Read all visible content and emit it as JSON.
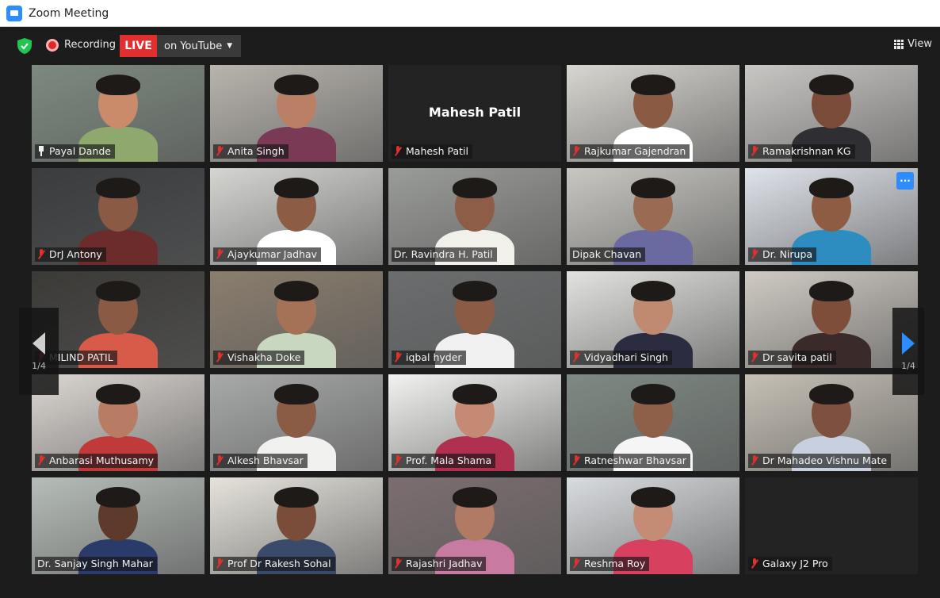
{
  "window": {
    "title": "Zoom Meeting"
  },
  "toolbar": {
    "recording_label": "Recording",
    "live_label": "LIVE",
    "youtube_label": "on YouTube",
    "view_label": "View"
  },
  "colors": {
    "accent": "#2d8cff",
    "live_red": "#e02f2f",
    "active_speaker": "#b9e35a",
    "muted_mic": "#e03030"
  },
  "pagination": {
    "left": "1/4",
    "right": "1/4"
  },
  "participants": [
    {
      "name": "Payal Dande",
      "status": "pinned",
      "active_speaker": true
    },
    {
      "name": "Anita Singh",
      "status": "muted"
    },
    {
      "name": "Mahesh Patil",
      "status": "muted",
      "video": "off"
    },
    {
      "name": "Rajkumar Gajendran",
      "status": "muted"
    },
    {
      "name": "Ramakrishnan KG",
      "status": "muted"
    },
    {
      "name": "DrJ Antony",
      "status": "muted"
    },
    {
      "name": "Ajaykumar Jadhav",
      "status": "muted"
    },
    {
      "name": "Dr. Ravindra H. Patil",
      "status": "unmuted"
    },
    {
      "name": "Dipak Chavan",
      "status": "unmuted"
    },
    {
      "name": "Dr. Nirupa",
      "status": "muted",
      "more_menu": true
    },
    {
      "name": "MILIND PATIL",
      "status": "muted"
    },
    {
      "name": "Vishakha Doke",
      "status": "muted"
    },
    {
      "name": "iqbal hyder",
      "status": "muted"
    },
    {
      "name": "Vidyadhari Singh",
      "status": "muted"
    },
    {
      "name": "Dr savita patil",
      "status": "muted"
    },
    {
      "name": "Anbarasi Muthusamy",
      "status": "muted"
    },
    {
      "name": "Alkesh Bhavsar",
      "status": "muted"
    },
    {
      "name": "Prof. Mala Shama",
      "status": "muted"
    },
    {
      "name": "Ratneshwar Bhavsar",
      "status": "muted"
    },
    {
      "name": "Dr Mahadeo Vishnu Mate",
      "status": "muted"
    },
    {
      "name": "Dr. Sanjay Singh Mahar",
      "status": "unmuted"
    },
    {
      "name": "Prof Dr Rakesh Sohal",
      "status": "muted"
    },
    {
      "name": "Rajashri Jadhav",
      "status": "muted"
    },
    {
      "name": "Reshma Roy",
      "status": "muted"
    },
    {
      "name": "Galaxy J2 Pro",
      "status": "muted",
      "video": "off"
    }
  ]
}
